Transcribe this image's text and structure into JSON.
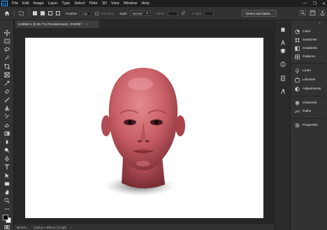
{
  "app": {
    "logo_text": "Ps"
  },
  "menu": [
    "File",
    "Edit",
    "Image",
    "Layer",
    "Type",
    "Select",
    "Filter",
    "3D",
    "View",
    "Window",
    "Help"
  ],
  "window_controls": [
    "—",
    "❐",
    "✕"
  ],
  "options_bar": {
    "feather_label": "Feather:",
    "feather_value": "0 px",
    "antialias_label": "Anti-alias",
    "style_label": "Style:",
    "style_value": "Normal",
    "width_label": "Width:",
    "height_label": "Height:",
    "select_mask_label": "Select and Mask..."
  },
  "document": {
    "tab_title": "Untitled-1 @ 66.7% (FemaleHead1, RGB/8) *",
    "close": "×"
  },
  "status": {
    "zoom": "66.67%",
    "info": "1120 px x 860 px (72 ppi)",
    "arrow": "›"
  },
  "panels": [
    {
      "label": "Color",
      "icon": "color-wheel-icon"
    },
    {
      "label": "Swatches",
      "icon": "swatches-grid-icon"
    },
    {
      "label": "Gradients",
      "icon": "gradient-icon"
    },
    {
      "label": "Patterns",
      "icon": "pattern-icon"
    },
    {
      "label": "Learn",
      "icon": "lightbulb-icon"
    },
    {
      "label": "Libraries",
      "icon": "library-icon"
    },
    {
      "label": "Adjustments",
      "icon": "adjustments-icon"
    },
    {
      "label": "Channels",
      "icon": "channels-icon"
    },
    {
      "label": "Paths",
      "icon": "paths-icon"
    },
    {
      "label": "Properties",
      "icon": "properties-icon"
    }
  ],
  "colors": {
    "foreground": "#000000",
    "background": "#ffffff",
    "head_skin": "#c75d64",
    "accent": "#31a8ff"
  }
}
